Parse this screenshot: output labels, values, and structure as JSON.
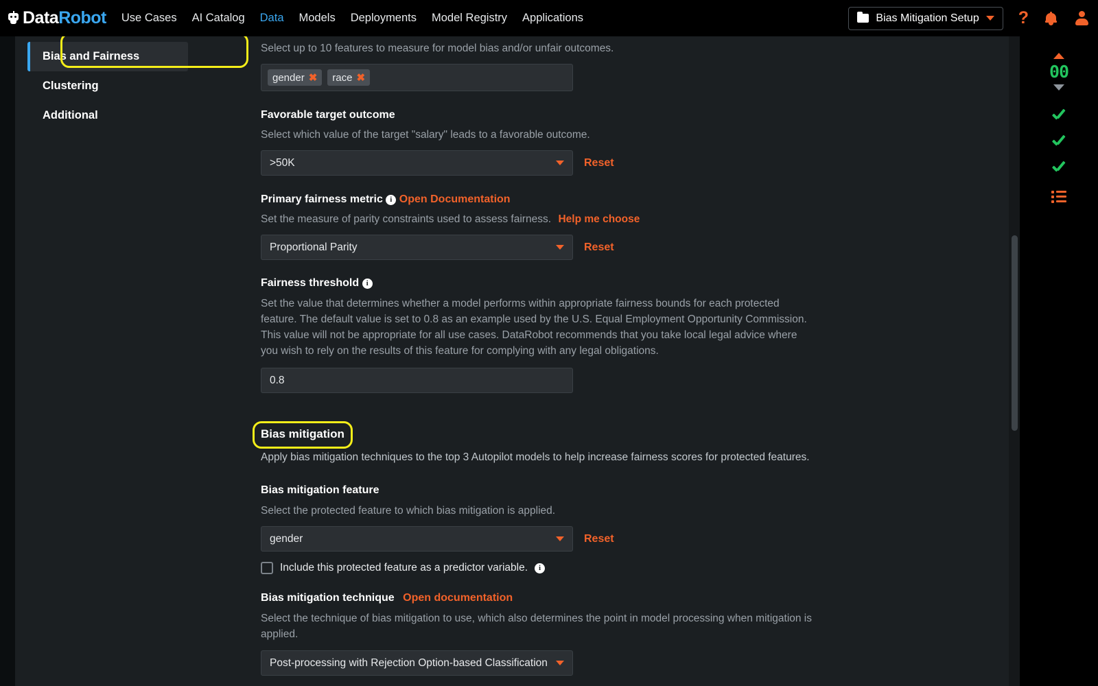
{
  "brand": {
    "name_white": "Data",
    "name_blue": "Robot",
    "logo_icon": "robot-head-icon"
  },
  "topnav": {
    "links": [
      {
        "label": "Use Cases",
        "active": false
      },
      {
        "label": "AI Catalog",
        "active": false
      },
      {
        "label": "Data",
        "active": true
      },
      {
        "label": "Models",
        "active": false
      },
      {
        "label": "Deployments",
        "active": false
      },
      {
        "label": "Model Registry",
        "active": false
      },
      {
        "label": "Applications",
        "active": false
      }
    ],
    "project": {
      "label": "Bias Mitigation Setup",
      "icon": "folder-icon",
      "caret": "chevron-down-icon"
    },
    "help_icon": "?",
    "bell_icon": "bell-icon",
    "user_icon": "user-avatar-icon"
  },
  "sidebar": {
    "items": [
      {
        "label": "Bias and Fairness",
        "active": true
      },
      {
        "label": "Clustering",
        "active": false
      },
      {
        "label": "Additional",
        "active": false
      }
    ]
  },
  "form": {
    "protected_features": {
      "helper": "Select up to 10 features to measure for model bias and/or unfair outcomes.",
      "chips": [
        {
          "label": "gender",
          "remove": "✖"
        },
        {
          "label": "race",
          "remove": "✖"
        }
      ]
    },
    "favorable_outcome": {
      "label": "Favorable target outcome",
      "helper": "Select which value of the target \"salary\" leads to a favorable outcome.",
      "value": ">50K",
      "reset": "Reset"
    },
    "fairness_metric": {
      "label": "Primary fairness metric",
      "info": "i",
      "doc_link": "Open Documentation",
      "helper": "Set the measure of parity constraints used to assess fairness.",
      "help_link": "Help me choose",
      "value": "Proportional Parity",
      "reset": "Reset"
    },
    "fairness_threshold": {
      "label": "Fairness threshold",
      "info": "i",
      "helper": "Set the value that determines whether a model performs within appropriate fairness bounds for each protected feature. The default value is set to 0.8 as an example used by the U.S. Equal Employment Opportunity Commission. This value will not be appropriate for all use cases. DataRobot recommends that you take local legal advice where you wish to rely on the results of this feature for complying with any legal obligations.",
      "value": "0.8"
    },
    "bias_mitigation": {
      "heading": "Bias mitigation",
      "helper": "Apply bias mitigation techniques to the top 3 Autopilot models to help increase fairness scores for protected features."
    },
    "mitigation_feature": {
      "label": "Bias mitigation feature",
      "helper": "Select the protected feature to which bias mitigation is applied.",
      "value": "gender",
      "reset": "Reset",
      "checkbox_label": "Include this protected feature as a predictor variable.",
      "checkbox_info": "i",
      "checked": false
    },
    "mitigation_technique": {
      "label": "Bias mitigation technique",
      "doc_link": "Open documentation",
      "helper": "Select the technique of bias mitigation to use, which also determines the point in model processing when mitigation is applied.",
      "value": "Post-processing with Rejection Option-based Classification"
    }
  },
  "right_rail": {
    "caret_up": "chevron-up-icon",
    "count": "00",
    "caret_down": "chevron-down-icon",
    "checks": [
      "check-icon",
      "check-icon",
      "check-icon"
    ],
    "list_icon": "list-icon"
  },
  "colors": {
    "accent_orange": "#f2622a",
    "accent_blue": "#3aa7f0",
    "highlight_yellow": "#f5ee19",
    "success_green": "#22c55e",
    "page_bg": "#1b1f22",
    "field_bg": "#2b2f33"
  }
}
